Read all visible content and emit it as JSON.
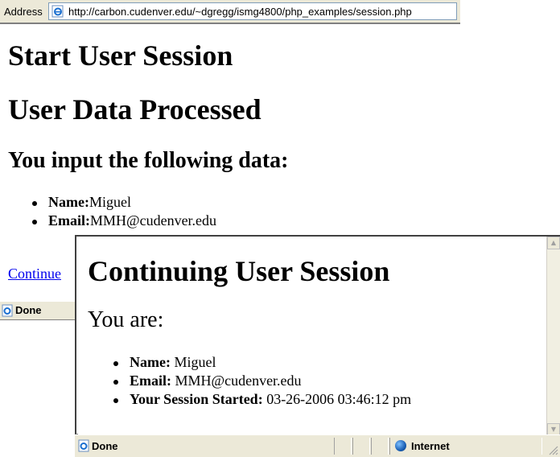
{
  "back_window": {
    "address_label": "Address",
    "url": "http://carbon.cudenver.edu/~dgregg/ismg4800/php_examples/session.php",
    "heading1": "Start User Session",
    "heading2": "User Data Processed",
    "heading3": "You input the following data:",
    "items": [
      {
        "label": "Name:",
        "value": "Miguel"
      },
      {
        "label": "Email:",
        "value": "MMH@cudenver.edu"
      }
    ],
    "link": "Continue",
    "status": "Done"
  },
  "front_window": {
    "heading1": "Continuing User Session",
    "heading2": "You are:",
    "items": [
      {
        "label": "Name:",
        "value": " Miguel"
      },
      {
        "label": "Email:",
        "value": " MMH@cudenver.edu"
      },
      {
        "label": "Your Session Started:",
        "value": " 03-26-2006 03:46:12 pm"
      }
    ],
    "status": "Done",
    "zone": "Internet"
  },
  "icons": {
    "page_icon": "ie-page-icon",
    "zone_icon": "globe-icon"
  },
  "colors": {
    "chrome": "#ece9d8",
    "link": "#0000ee"
  }
}
